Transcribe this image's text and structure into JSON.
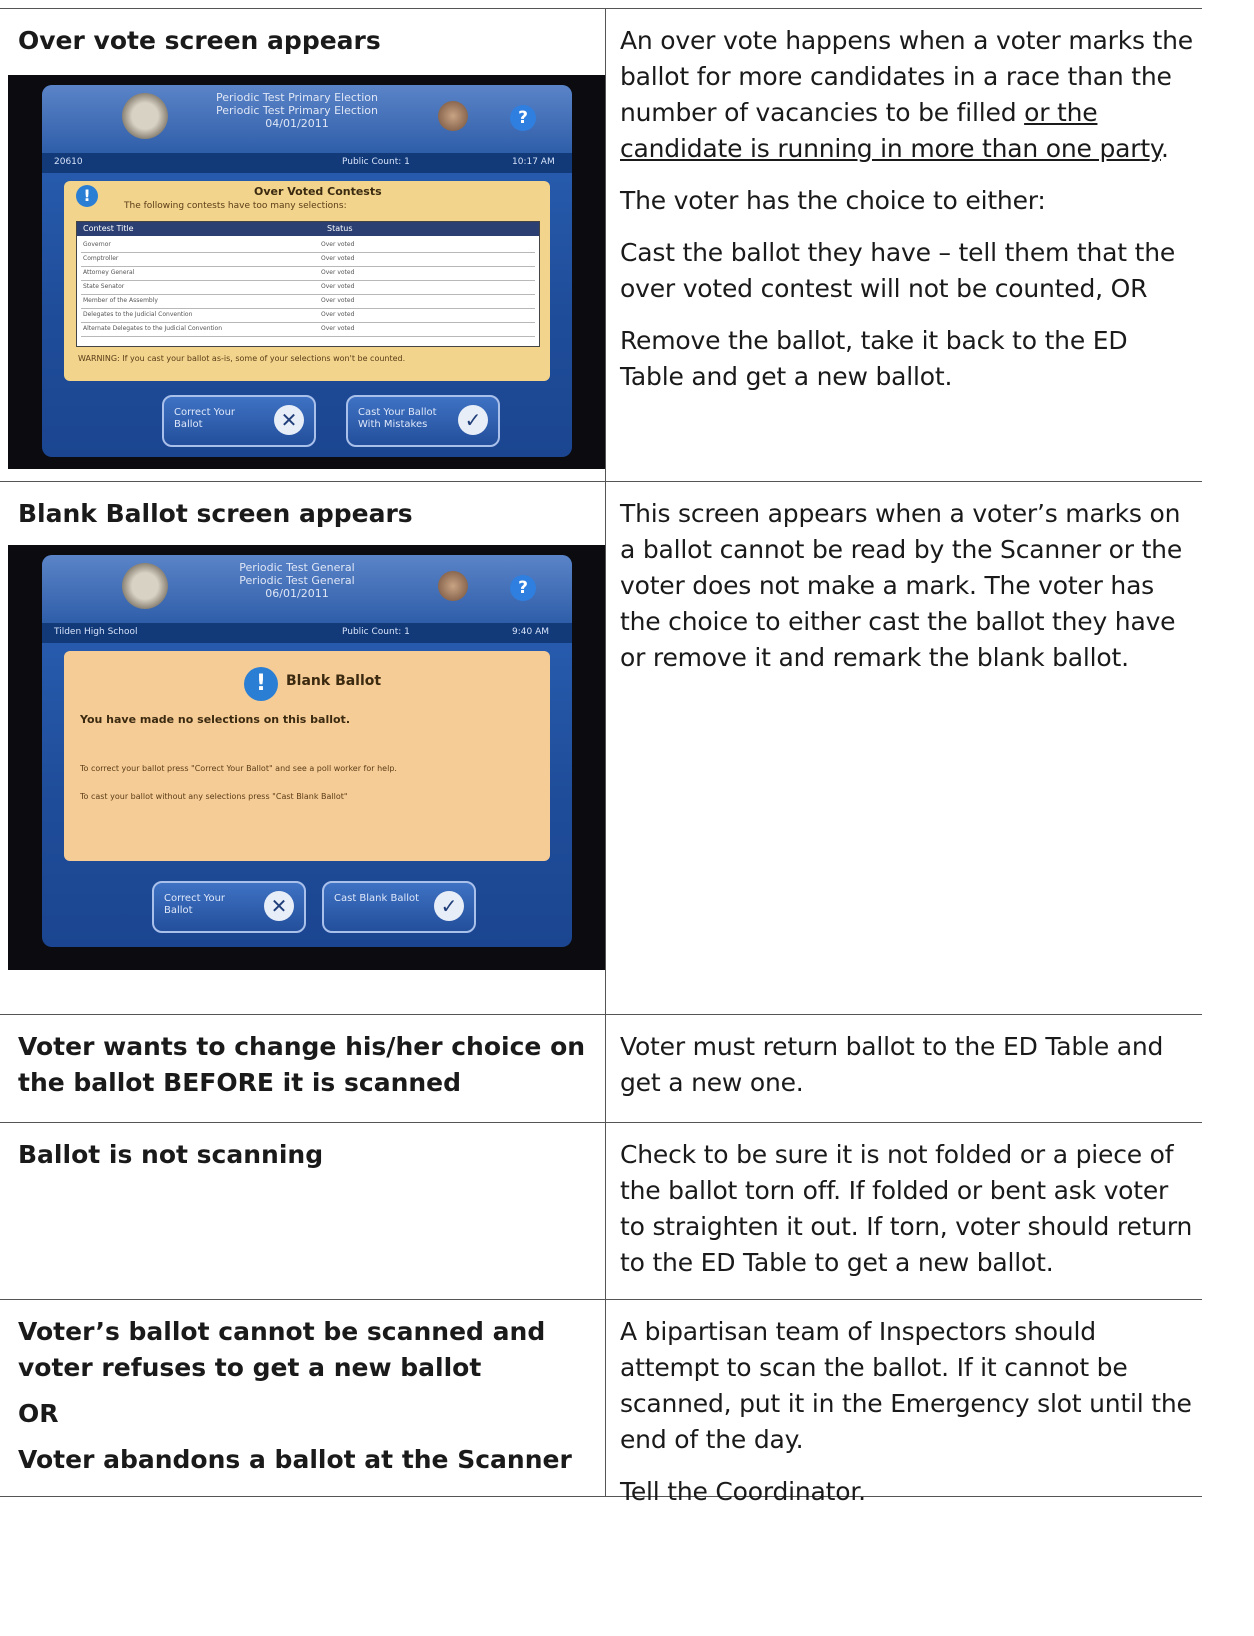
{
  "rows": [
    {
      "heading": "Over vote screen appears",
      "photo": {
        "title_lines": [
          "Periodic Test Primary Election",
          "Periodic Test Primary Election",
          "04/01/2011"
        ],
        "bar_left": "20610",
        "bar_count": "Public Count: 1",
        "bar_time": "10:17 AM",
        "panel_title": "Over Voted Contests",
        "panel_subtitle": "The following contests have too many selections:",
        "col_title": "Contest Title",
        "col_status": "Status",
        "contests": [
          {
            "name": "Governor",
            "status": "Over voted"
          },
          {
            "name": "Comptroller",
            "status": "Over voted"
          },
          {
            "name": "Attorney General",
            "status": "Over voted"
          },
          {
            "name": "State Senator",
            "status": "Over voted"
          },
          {
            "name": "Member of the Assembly",
            "status": "Over voted"
          },
          {
            "name": "Delegates to the Judicial Convention",
            "status": "Over voted"
          },
          {
            "name": "Alternate Delegates to the Judicial Convention",
            "status": "Over voted"
          }
        ],
        "warning": "WARNING: If you cast your ballot as-is, some of your selections won't be counted.",
        "btn_correct": "Correct Your Ballot",
        "btn_cast": "Cast Your Ballot With Mistakes"
      },
      "body": [
        {
          "pre": "An over vote happens when a voter marks the ballot for more candidates in a race than the number of vacancies to be filled ",
          "underline": "or the candidate is running in more than one party",
          "post": "."
        },
        {
          "pre": "The voter has the choice to either:"
        },
        {
          "pre": "Cast the ballot they have – tell them that the over voted contest will not be counted, OR"
        },
        {
          "pre": "Remove the ballot, take it back to the ED Table and get a new ballot."
        }
      ]
    },
    {
      "heading": "Blank Ballot screen appears",
      "photo": {
        "title_lines": [
          "Periodic Test General",
          "Periodic Test General",
          "06/01/2011"
        ],
        "bar_left": "Tilden High School",
        "bar_count": "Public Count: 1",
        "bar_time": "9:40 AM",
        "panel_title": "Blank Ballot",
        "panel_subtitle": "You have made no selections on this ballot.",
        "instr1": "To correct your ballot press \"Correct Your Ballot\" and see a poll worker for help.",
        "instr2": "To cast your ballot without any selections press \"Cast Blank Ballot\"",
        "btn_correct": "Correct Your Ballot",
        "btn_cast": "Cast Blank Ballot"
      },
      "body": [
        {
          "pre": "This screen appears when a voter’s marks on a ballot cannot be read by the Scanner or the voter does not make a mark. The voter has the choice to either cast the ballot they have or remove it and remark the blank ballot."
        }
      ]
    },
    {
      "heading": "Voter wants to change his/her choice on the ballot BEFORE it is scanned",
      "body": [
        {
          "pre": "Voter must return ballot to the ED Table and get a new one."
        }
      ]
    },
    {
      "heading": "Ballot is not scanning",
      "body": [
        {
          "pre": "Check to be sure it is not folded or a piece of the ballot torn off. If folded or bent ask voter to straighten it out. If torn, voter should return to the ED Table to get a new ballot."
        }
      ]
    },
    {
      "headings": [
        "Voter’s ballot cannot be scanned and voter refuses to get a new ballot",
        "OR",
        "Voter abandons a ballot at the Scanner"
      ],
      "body": [
        {
          "pre": "A bipartisan team of Inspectors should attempt to scan the ballot. If it cannot be scanned, put it in the Emergency slot until the end of the day."
        },
        {
          "pre": "Tell the Coordinator."
        }
      ]
    }
  ]
}
